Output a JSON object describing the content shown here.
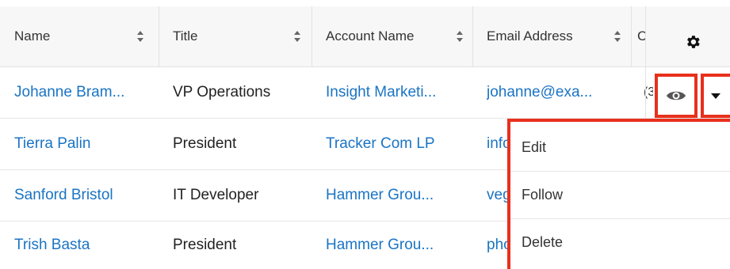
{
  "header": {
    "columns": [
      "Name",
      "Title",
      "Account Name",
      "Email Address",
      "C"
    ],
    "settings_icon": "gear-icon"
  },
  "rows": [
    {
      "name": "Johanne Bram...",
      "title": "VP Operations",
      "account": "Insight Marketi...",
      "email": "johanne@exa...",
      "phone": "(3"
    },
    {
      "name": "Tierra Palin",
      "title": "President",
      "account": "Tracker Com LP",
      "email": "info",
      "phone": ""
    },
    {
      "name": "Sanford Bristol",
      "title": "IT Developer",
      "account": "Hammer Grou...",
      "email": "veg",
      "phone": ""
    },
    {
      "name": "Trish Basta",
      "title": "President",
      "account": "Hammer Grou...",
      "email": "pho",
      "phone": ""
    }
  ],
  "row_actions": {
    "preview_icon": "eye-icon",
    "dropdown_icon": "caret-down-icon"
  },
  "menu": {
    "items": [
      "Edit",
      "Follow",
      "Delete"
    ]
  },
  "colors": {
    "link": "#1a74c4",
    "highlight": "#e8301c"
  }
}
